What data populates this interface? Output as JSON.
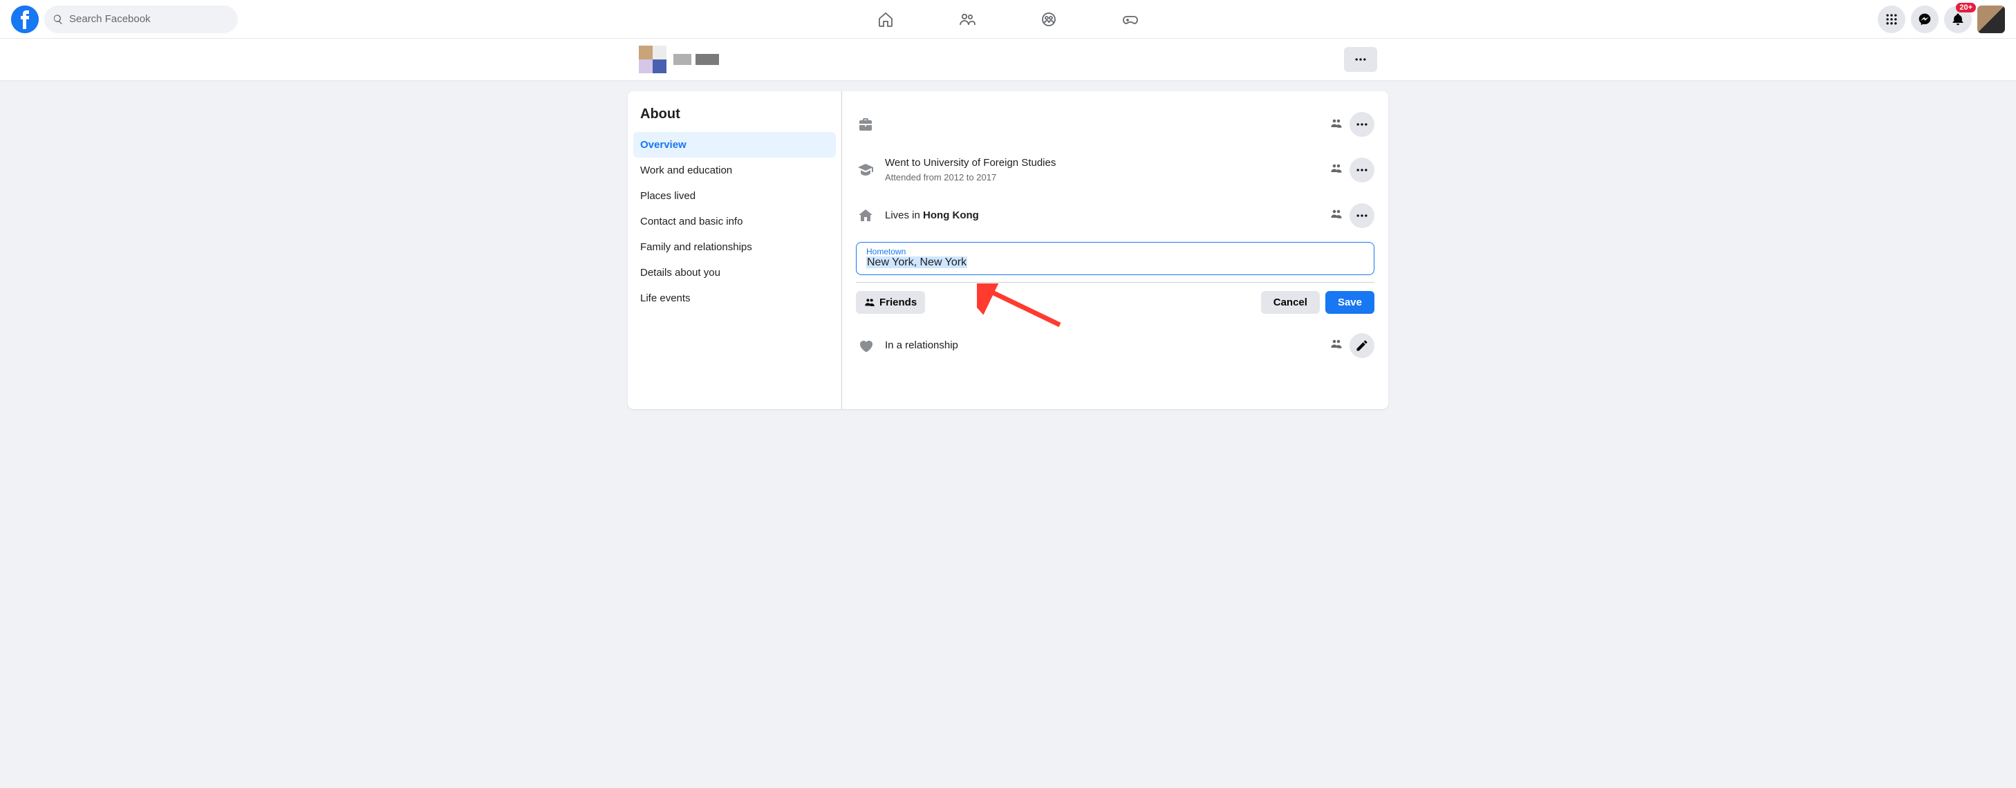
{
  "header": {
    "search_placeholder": "Search Facebook",
    "notifications_badge": "20+"
  },
  "sidebar": {
    "title": "About",
    "items": [
      {
        "label": "Overview",
        "active": true
      },
      {
        "label": "Work and education"
      },
      {
        "label": "Places lived"
      },
      {
        "label": "Contact and basic info"
      },
      {
        "label": "Family and relationships"
      },
      {
        "label": "Details about you"
      },
      {
        "label": "Life events"
      }
    ]
  },
  "overview": {
    "education": {
      "line_prefix": "Went to ",
      "school": "University of Foreign Studies",
      "sub": "Attended from 2012 to 2017"
    },
    "current_city": {
      "prefix": "Lives in ",
      "city": "Hong Kong"
    },
    "hometown": {
      "label": "Hometown",
      "value": "New York, New York"
    },
    "relationship": {
      "text": "In a relationship"
    },
    "audience_button": "Friends",
    "cancel": "Cancel",
    "save": "Save"
  }
}
